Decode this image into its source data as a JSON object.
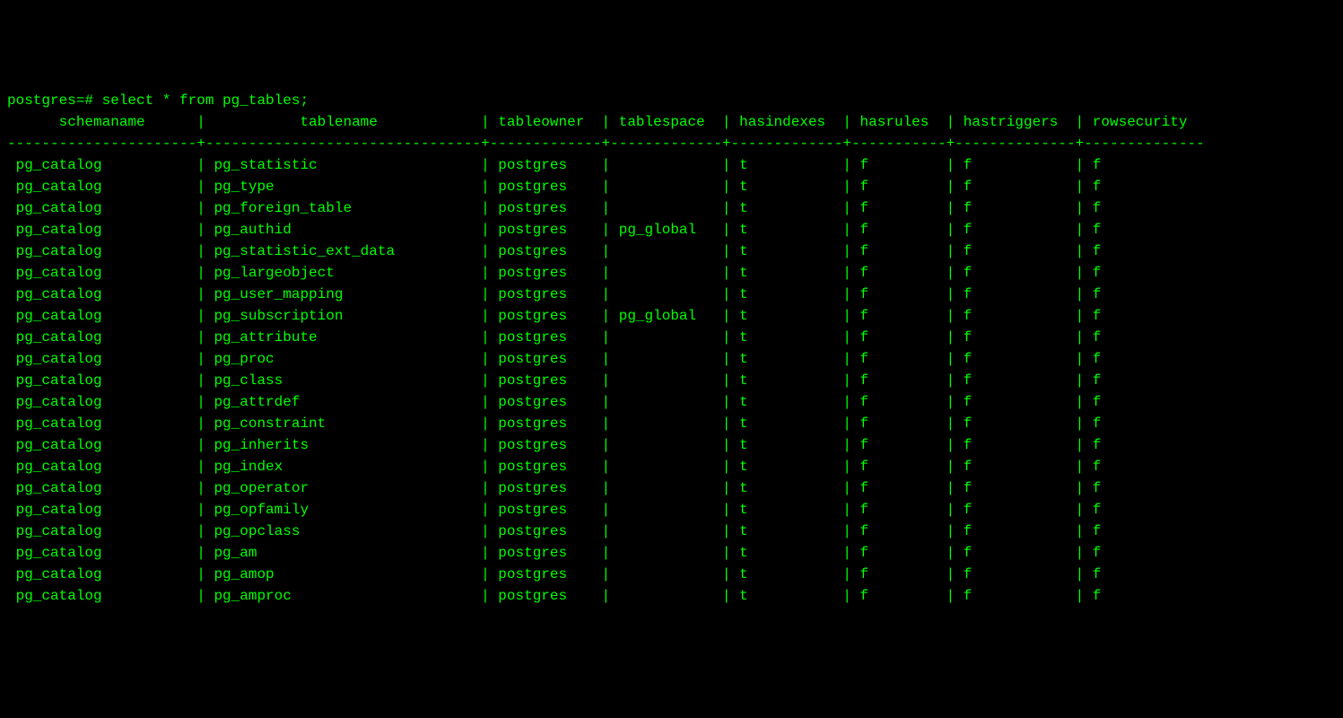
{
  "prompt": "postgres=# select * from pg_tables;",
  "columns": [
    {
      "name": "schemaname",
      "width": 22,
      "align": "center"
    },
    {
      "name": "tablename",
      "width": 32,
      "align": "center"
    },
    {
      "name": "tableowner",
      "width": 13,
      "align": "center"
    },
    {
      "name": "tablespace",
      "width": 13,
      "align": "center"
    },
    {
      "name": "hasindexes",
      "width": 13,
      "align": "center"
    },
    {
      "name": "hasrules",
      "width": 11,
      "align": "center"
    },
    {
      "name": "hastriggers",
      "width": 14,
      "align": "center"
    },
    {
      "name": "rowsecurity",
      "width": 14,
      "align": "center"
    }
  ],
  "rows": [
    [
      "pg_catalog",
      "pg_statistic",
      "postgres",
      "",
      "t",
      "f",
      "f",
      "f"
    ],
    [
      "pg_catalog",
      "pg_type",
      "postgres",
      "",
      "t",
      "f",
      "f",
      "f"
    ],
    [
      "pg_catalog",
      "pg_foreign_table",
      "postgres",
      "",
      "t",
      "f",
      "f",
      "f"
    ],
    [
      "pg_catalog",
      "pg_authid",
      "postgres",
      "pg_global",
      "t",
      "f",
      "f",
      "f"
    ],
    [
      "pg_catalog",
      "pg_statistic_ext_data",
      "postgres",
      "",
      "t",
      "f",
      "f",
      "f"
    ],
    [
      "pg_catalog",
      "pg_largeobject",
      "postgres",
      "",
      "t",
      "f",
      "f",
      "f"
    ],
    [
      "pg_catalog",
      "pg_user_mapping",
      "postgres",
      "",
      "t",
      "f",
      "f",
      "f"
    ],
    [
      "pg_catalog",
      "pg_subscription",
      "postgres",
      "pg_global",
      "t",
      "f",
      "f",
      "f"
    ],
    [
      "pg_catalog",
      "pg_attribute",
      "postgres",
      "",
      "t",
      "f",
      "f",
      "f"
    ],
    [
      "pg_catalog",
      "pg_proc",
      "postgres",
      "",
      "t",
      "f",
      "f",
      "f"
    ],
    [
      "pg_catalog",
      "pg_class",
      "postgres",
      "",
      "t",
      "f",
      "f",
      "f"
    ],
    [
      "pg_catalog",
      "pg_attrdef",
      "postgres",
      "",
      "t",
      "f",
      "f",
      "f"
    ],
    [
      "pg_catalog",
      "pg_constraint",
      "postgres",
      "",
      "t",
      "f",
      "f",
      "f"
    ],
    [
      "pg_catalog",
      "pg_inherits",
      "postgres",
      "",
      "t",
      "f",
      "f",
      "f"
    ],
    [
      "pg_catalog",
      "pg_index",
      "postgres",
      "",
      "t",
      "f",
      "f",
      "f"
    ],
    [
      "pg_catalog",
      "pg_operator",
      "postgres",
      "",
      "t",
      "f",
      "f",
      "f"
    ],
    [
      "pg_catalog",
      "pg_opfamily",
      "postgres",
      "",
      "t",
      "f",
      "f",
      "f"
    ],
    [
      "pg_catalog",
      "pg_opclass",
      "postgres",
      "",
      "t",
      "f",
      "f",
      "f"
    ],
    [
      "pg_catalog",
      "pg_am",
      "postgres",
      "",
      "t",
      "f",
      "f",
      "f"
    ],
    [
      "pg_catalog",
      "pg_amop",
      "postgres",
      "",
      "t",
      "f",
      "f",
      "f"
    ],
    [
      "pg_catalog",
      "pg_amproc",
      "postgres",
      "",
      "t",
      "f",
      "f",
      "f"
    ]
  ]
}
